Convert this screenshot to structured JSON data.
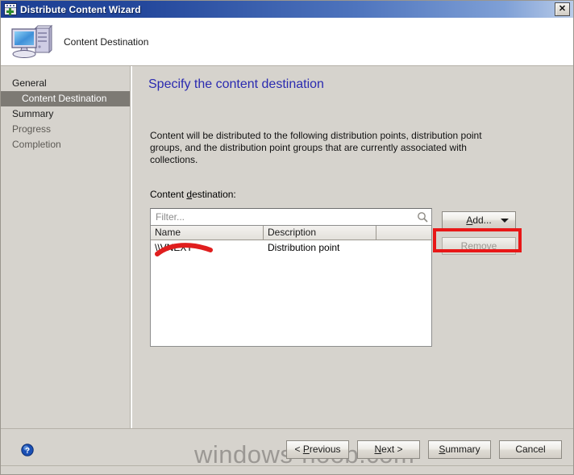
{
  "window": {
    "title": "Distribute Content Wizard",
    "title_icon": "wizard-window-plus-icon",
    "close_label": "✕"
  },
  "header": {
    "title": "Content Destination",
    "icon": "computer-icon"
  },
  "sidebar": {
    "items": [
      {
        "label": "General",
        "selected": false,
        "dim": false
      },
      {
        "label": "Content Destination",
        "selected": true,
        "dim": false
      },
      {
        "label": "Summary",
        "selected": false,
        "dim": false
      },
      {
        "label": "Progress",
        "selected": false,
        "dim": true
      },
      {
        "label": "Completion",
        "selected": false,
        "dim": true
      }
    ]
  },
  "content": {
    "heading": "Specify the content destination",
    "intro": "Content will be distributed to the following distribution points, distribution point groups, and the distribution point groups that are currently associated with collections.",
    "field_label_pre": "Content ",
    "field_label_accel": "d",
    "field_label_post": "estination:"
  },
  "filter": {
    "placeholder": "Filter...",
    "value": "",
    "icon": "search-icon"
  },
  "table": {
    "columns": [
      "Name",
      "Description",
      ""
    ],
    "rows": [
      {
        "name": "\\\\VNEXT",
        "description": "Distribution point",
        "extra": ""
      }
    ]
  },
  "side_buttons": {
    "add": {
      "pre": "",
      "accel": "A",
      "post": "dd...",
      "enabled": true,
      "has_dropdown": true
    },
    "remove": {
      "pre": "",
      "accel": "R",
      "post": "emove",
      "enabled": false
    }
  },
  "footer": {
    "help_icon": "help-question-icon",
    "buttons": [
      {
        "pre": "< ",
        "accel": "P",
        "post": "revious"
      },
      {
        "pre": "",
        "accel": "N",
        "post": "ext >"
      },
      {
        "pre": "",
        "accel": "S",
        "post": "ummary"
      },
      {
        "pre": "",
        "accel": "",
        "post": "Cancel"
      }
    ]
  },
  "watermark": {
    "text": "windows-noob.com"
  },
  "annotations": {
    "add_button_highlight_color": "#e81717",
    "vnext_underline_color": "#e01e1e"
  },
  "colors": {
    "titlebar_start": "#1c3f94",
    "titlebar_end": "#b9cce9",
    "dialog_bg": "#d6d3cd",
    "heading": "#2a2ab0",
    "selected_item_bg": "#7d7a74"
  }
}
